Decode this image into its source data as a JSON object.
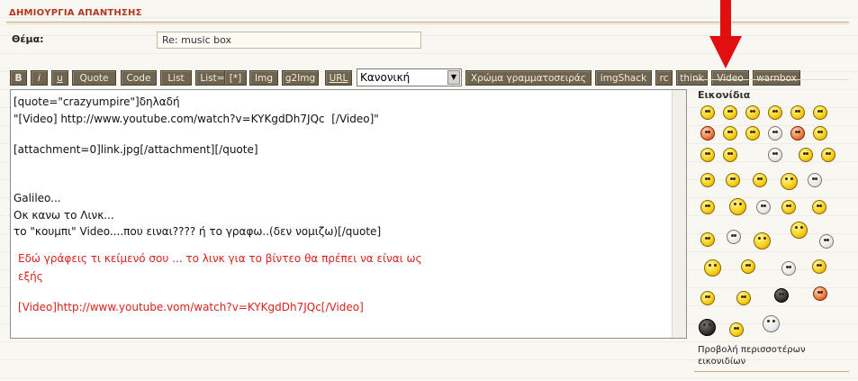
{
  "header": {
    "title": "ΔΗΜΙΟΥΡΓΙΑ ΑΠΑΝΤΗΣΗΣ"
  },
  "subject": {
    "label": "Θέμα:",
    "value": "Re: music box"
  },
  "toolbar": {
    "buttons": [
      "B",
      "i",
      "u",
      "Quote",
      "Code",
      "List",
      "List=",
      "[*]",
      "Img",
      "g2Img",
      "URL",
      "Χρώμα γραμματοσειράς",
      "imgShack",
      "rc",
      "think",
      "Video",
      "warnbox"
    ],
    "font_size_select": "Κανονική"
  },
  "editor": {
    "lines": [
      "[quote=\"crazyumpire\"]δηλαδή",
      "\"[Video] http://www.youtube.com/watch?v=KYKgdDh7JQc  [/Video]\"",
      "",
      "[attachment=0]link.jpg[/attachment][/quote]",
      "",
      "",
      "Galileo...",
      "Οκ κανω το Λινκ...",
      "το \"κουμπι\" Video....που ειναι???? ή το γραφω..(δεν νομιζω)[/quote]"
    ],
    "note_lines": [
      "Εδώ γράφεις τι κείμενό σου ... το λινκ για το βίντεο θα πρέπει να είναι ως",
      "εξής",
      "",
      "[Video]http://www.youtube.vom/watch?v=KYKgdDh7JQc[/Video]"
    ]
  },
  "smilies": {
    "title": "Εικονίδια",
    "more_link": [
      "Προβολή περισσοτέρων",
      "εικονιδίων"
    ],
    "icons": [
      "smile-icon",
      "grin-icon",
      "sad-icon",
      "surprised-icon",
      "wink-icon",
      "eek-icon",
      "evil-icon",
      "lol-icon",
      "cool-icon",
      "confused-icon",
      "mad-icon",
      "razz-icon",
      "shocked-icon",
      "ghost-icon",
      "exclaim-icon",
      "question-icon",
      "idea-icon",
      "arrow-icon",
      "neutral-icon",
      "wave-icon",
      "thumbs-icon",
      "cry-icon",
      "rolleyes-icon",
      "eyes-icon",
      "clap-icon",
      "angel-icon",
      "drool-icon",
      "speech-icon",
      "think-icon",
      "happy-icon",
      "sleep-icon",
      "bow-icon",
      "scream-icon",
      "hang-icon",
      "peace-icon",
      "shy-icon",
      "blink-icon",
      "ninja-icon",
      "angry-icon",
      "devil-icon",
      "beer-icon",
      "santa-icon"
    ]
  },
  "colors": {
    "button_bg": "#6e6450",
    "accent": "#b0361f",
    "note_text": "#d8231c",
    "arrow": "#e01010"
  }
}
